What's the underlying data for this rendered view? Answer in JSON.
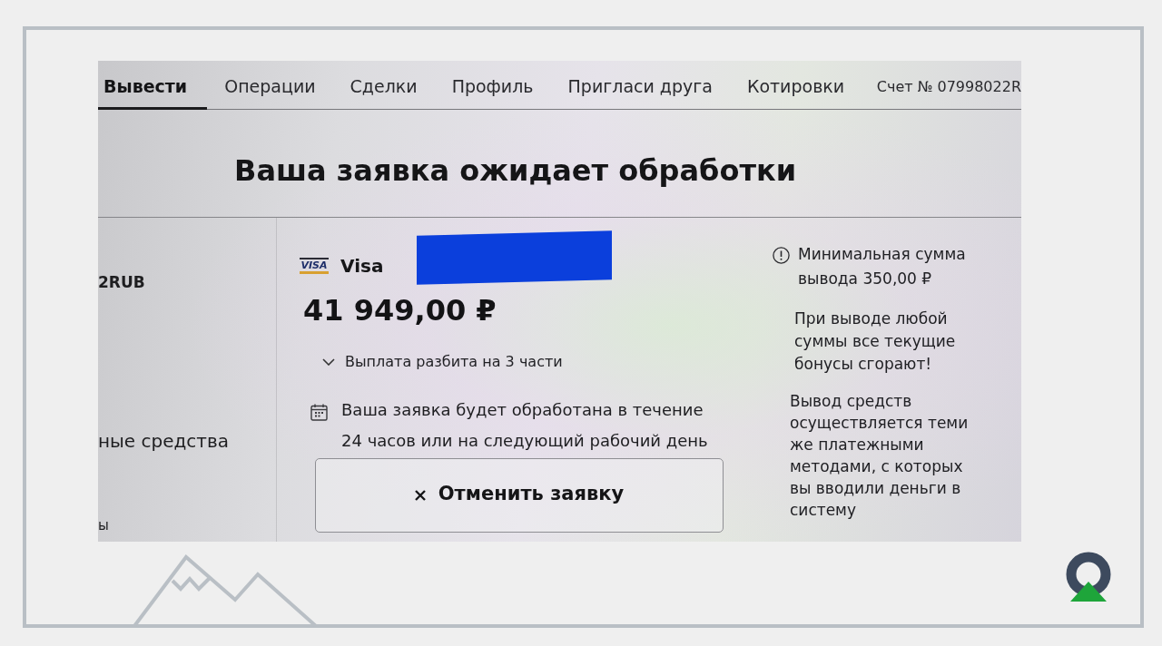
{
  "nav": {
    "tabs": [
      {
        "label": "Вывести",
        "selected": true
      },
      {
        "label": "Операции",
        "selected": false
      },
      {
        "label": "Сделки",
        "selected": false
      },
      {
        "label": "Профиль",
        "selected": false
      },
      {
        "label": "Пригласи друга",
        "selected": false
      },
      {
        "label": "Котировки",
        "selected": false
      }
    ],
    "account": "Счет № 07998022R"
  },
  "heading": "Ваша заявка ожидает обработки",
  "left_column": [
    {
      "kind": "account",
      "text": "2RUB"
    },
    {
      "kind": "menu",
      "text": "ные средства"
    },
    {
      "kind": "menu_small",
      "text": "ы"
    }
  ],
  "withdrawal": {
    "card_logo": "VISA",
    "method": "Visa",
    "amount": "41 949,00 ₽",
    "split": {
      "label": "Выплата разбита на 3 части",
      "expanded": false
    },
    "notice": "Ваша заявка будет обработана в течение 24 часов или на следующий рабочий день",
    "cancel_button": "Отменить заявку"
  },
  "info": {
    "minimum": "Минимальная сумма вывода 350,00 ₽",
    "notes": [
      "При выводе любой суммы все текущие бонусы сгорают!",
      "Вывод средств осуществляется теми же платежными методами, с которых вы вводили деньги в систему"
    ]
  }
}
